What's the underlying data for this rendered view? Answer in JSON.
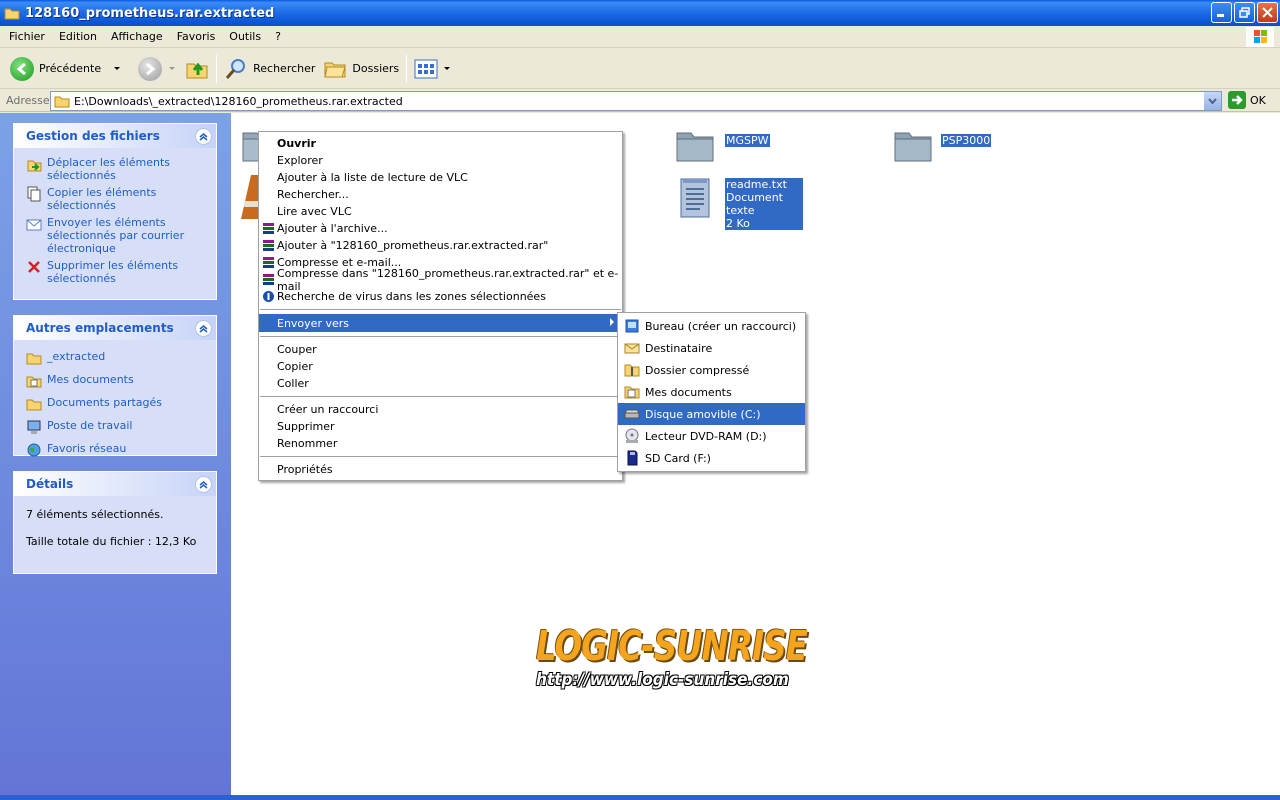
{
  "window": {
    "title": "128160_prometheus.rar.extracted"
  },
  "menu": [
    "Fichier",
    "Edition",
    "Affichage",
    "Favoris",
    "Outils",
    "?"
  ],
  "toolbar": {
    "back": "Précédente",
    "search": "Rechercher",
    "folders": "Dossiers"
  },
  "address": {
    "label": "Adresse",
    "path": "E:\\Downloads\\_extracted\\128160_prometheus.rar.extracted",
    "go": "OK"
  },
  "panels": {
    "file_tasks": {
      "title": "Gestion des fichiers",
      "items": [
        "Déplacer les éléments sélectionnés",
        "Copier les éléments sélectionnés",
        "Envoyer les éléments sélectionnés par courrier électronique",
        "Supprimer les éléments sélectionnés"
      ]
    },
    "other_places": {
      "title": "Autres emplacements",
      "items": [
        "_extracted",
        "Mes documents",
        "Documents partagés",
        "Poste de travail",
        "Favoris réseau"
      ]
    },
    "details": {
      "title": "Détails",
      "selected": "7 éléments sélectionnés.",
      "size": "Taille totale du fichier : 12,3 Ko"
    }
  },
  "files": {
    "mgspw": "MGSPW",
    "psp3000": "PSP3000",
    "readme_name": "readme.txt",
    "readme_type": "Document texte",
    "readme_size": "2 Ko"
  },
  "context_menu": [
    "Ouvrir",
    "Explorer",
    "Ajouter à la liste de lecture de VLC",
    "Rechercher...",
    "Lire avec VLC",
    "Ajouter à l'archive...",
    "Ajouter à \"128160_prometheus.rar.extracted.rar\"",
    "Compresse et e-mail...",
    "Compresse dans \"128160_prometheus.rar.extracted.rar\" et e-mail",
    "Recherche de virus dans les zones sélectionnées",
    "Envoyer vers",
    "Couper",
    "Copier",
    "Coller",
    "Créer un raccourci",
    "Supprimer",
    "Renommer",
    "Propriétés"
  ],
  "sendto_menu": [
    "Bureau (créer un raccourci)",
    "Destinataire",
    "Dossier compressé",
    "Mes documents",
    "Disque amovible (C:)",
    "Lecteur DVD-RAM (D:)",
    "SD Card (F:)"
  ],
  "watermark": {
    "title": "LOGIC-SUNRISE",
    "url": "http://www.logic-sunrise.com"
  },
  "colors": {
    "selection": "#316ac5",
    "task_link": "#215dc6",
    "titlebar": "#0a5ae0"
  }
}
